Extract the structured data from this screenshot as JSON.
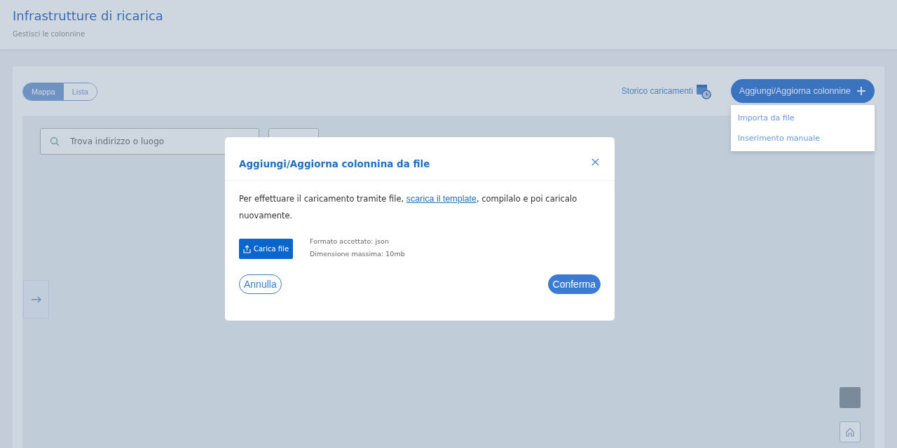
{
  "header": {
    "title": "Infrastrutture di ricarica",
    "subtitle": "Gestisci le colonnine"
  },
  "view_toggle": [
    {
      "label": "Mappa",
      "selected": true
    },
    {
      "label": "Lista",
      "selected": false
    }
  ],
  "history_link": {
    "label": "Storico caricamenti"
  },
  "add_button": {
    "label": "Aggiungi/Aggiorna colonnine"
  },
  "add_menu": [
    "Importa da file",
    "Inserimento manuale"
  ],
  "map": {
    "search": {
      "placeholder": "Trova indirizzo o luogo"
    }
  },
  "modal": {
    "title": "Aggiungi/Aggiorna colonnina da file",
    "text_before": "Per effettuare il caricamento tramite file, ",
    "link": "scarica il template",
    "text_after": ", compilalo e poi caricalo nuovamente.",
    "upload_button": "Carica file",
    "format": "Formato accettato: json",
    "max_size": "Dimensione massima: 10mb",
    "cancel": "Annulla",
    "confirm": "Conferma"
  }
}
